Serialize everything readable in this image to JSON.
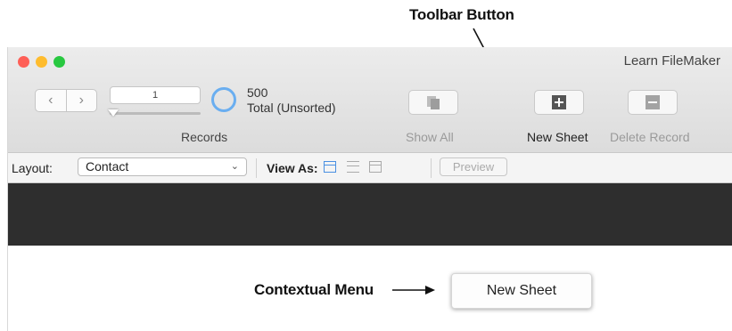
{
  "annotations": {
    "toolbar_button": "Toolbar Button",
    "contextual_menu": "Contextual Menu"
  },
  "window": {
    "title": "Learn FileMaker",
    "traffic_colors": [
      "#fe5f57",
      "#febc2e",
      "#28c840"
    ]
  },
  "toolbar": {
    "record_field_value": "1",
    "records_label": "Records",
    "count": "500",
    "count_status": "Total (Unsorted)",
    "show_all_label": "Show All",
    "new_sheet_label": "New Sheet",
    "delete_record_label": "Delete Record"
  },
  "format_bar": {
    "layout_label": "Layout:",
    "layout_value": "Contact",
    "view_as_label": "View As:",
    "preview_label": "Preview",
    "accent": "#4a90e2"
  },
  "context_menu": {
    "item": "New Sheet"
  }
}
